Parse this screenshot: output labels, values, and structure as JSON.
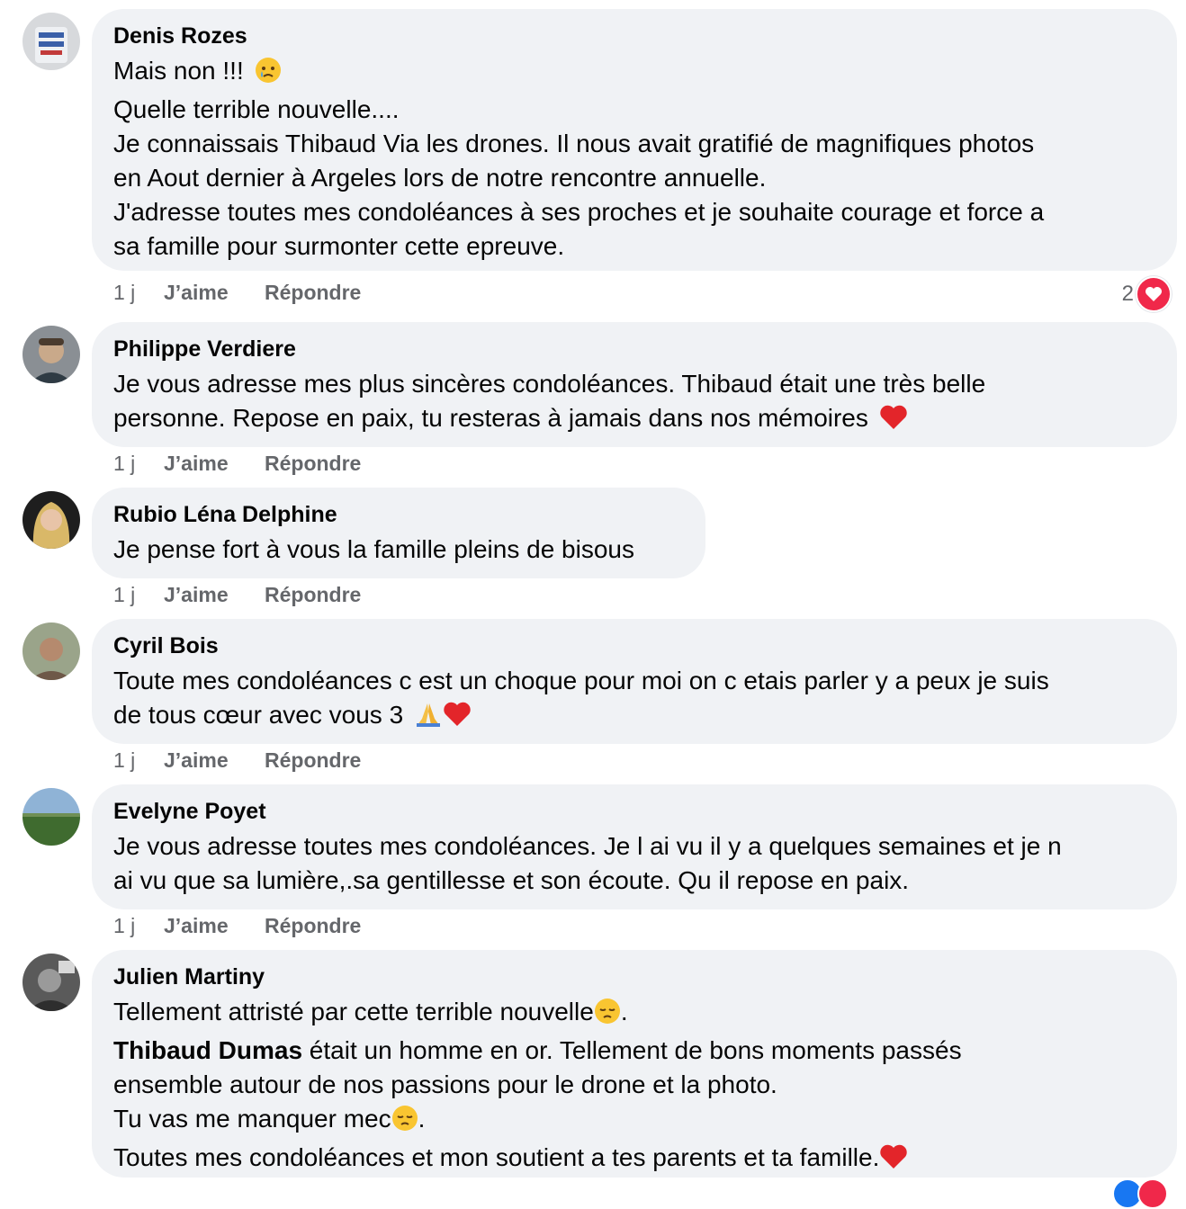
{
  "comments": [
    {
      "author": "Denis Rozes",
      "lines": [
        "Mais non !!! ",
        "Quelle terrible nouvelle....",
        "Je connaissais Thibaud Via les drones. Il nous avait gratifié de magnifiques photos",
        "en Aout dernier à Argeles lors de notre rencontre annuelle.",
        "J'adresse toutes mes condoléances à ses proches et je souhaite courage et force a",
        "sa famille pour surmonter cette epreuve."
      ],
      "time": "1 j",
      "like": "J’aime",
      "reply": "Répondre",
      "reaction_count": "2"
    },
    {
      "author": "Philippe Verdiere",
      "lines": [
        "Je vous adresse mes plus sincères condoléances. Thibaud était une très belle",
        "personne. Repose en paix, tu resteras à jamais dans nos mémoires "
      ],
      "time": "1 j",
      "like": "J’aime",
      "reply": "Répondre"
    },
    {
      "author": "Rubio Léna Delphine",
      "lines": [
        "Je pense fort à vous la famille pleins de bisous"
      ],
      "time": "1 j",
      "like": "J’aime",
      "reply": "Répondre"
    },
    {
      "author": "Cyril Bois",
      "lines": [
        "Toute mes condoléances c est un choque pour moi on c etais parler y a peux je suis",
        "de tous cœur avec vous 3 "
      ],
      "time": "1 j",
      "like": "J’aime",
      "reply": "Répondre"
    },
    {
      "author": "Evelyne Poyet",
      "lines": [
        "Je vous adresse toutes mes condoléances. Je l ai vu il y a quelques semaines et je n",
        "ai vu que sa lumière,.sa gentillesse et son écoute. Qu il repose en paix."
      ],
      "time": "1 j",
      "like": "J’aime",
      "reply": "Répondre"
    },
    {
      "author": "Julien Martiny",
      "lines": [
        "Tellement attristé par cette terrible nouvelle",
        "Thibaud Dumas",
        " était un homme en or. Tellement de bons moments passés",
        "ensemble autour de nos passions pour le drone et la photo.",
        "Tu vas me manquer mec",
        "Toutes mes condoléances et mon soutient a tes parents et ta famille."
      ]
    }
  ],
  "colors": {
    "bubble": "#f0f2f5",
    "meta": "#65676b",
    "heart": "#f0284a"
  },
  "icons": [
    "crying-face-emoji",
    "red-heart-emoji",
    "folded-hands-emoji",
    "pensive-face-emoji",
    "love-reaction-icon"
  ]
}
